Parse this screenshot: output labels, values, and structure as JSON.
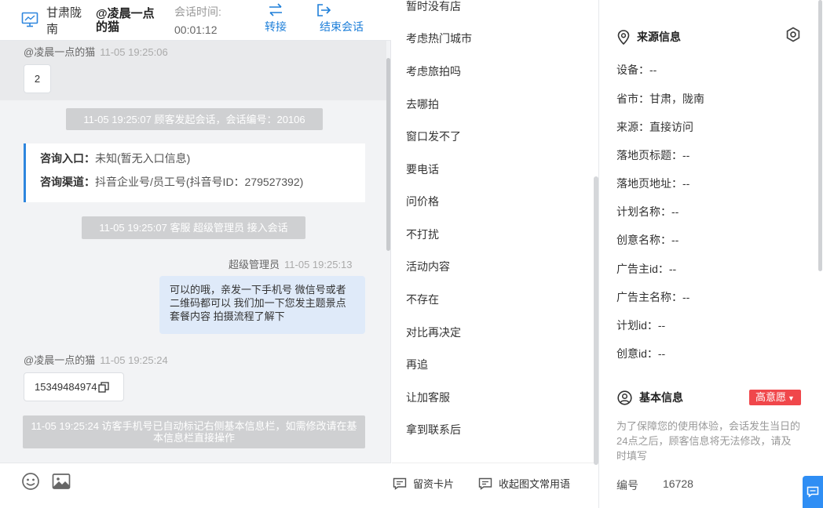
{
  "header": {
    "location": "甘肃陇南",
    "visitor_name": "@凌晨一点的猫",
    "session_time_label": "会话时间:",
    "session_time_value": "00:01:12",
    "transfer_label": "转接",
    "end_label": "结束会话"
  },
  "chat": {
    "msg1": {
      "sender": "@凌晨一点的猫",
      "time": "11-05 19:25:06",
      "text": "2"
    },
    "sys1": "11-05 19:25:07 顾客发起会话，会话编号：20106",
    "info_card": {
      "entry_label": "咨询入口：",
      "entry_value": "未知(暂无入口信息)",
      "channel_label": "咨询渠道：",
      "channel_value": "抖音企业号/员工号(抖音号ID：279527392)"
    },
    "sys2": "11-05 19:25:07 客服 超级管理员 接入会话",
    "msg2": {
      "sender": "超级管理员",
      "time": "11-05 19:25:13",
      "text": "可以的哦，亲发一下手机号 微信号或者二维码都可以 我们加一下您发主题景点 套餐内容 拍摄流程了解下"
    },
    "msg3": {
      "sender": "@凌晨一点的猫",
      "time": "11-05 19:25:24",
      "text": "15349484974"
    },
    "sys3": "11-05 19:25:24 访客手机号已自动标记右侧基本信息栏，如需修改请在基本信息栏直接操作"
  },
  "quick_replies": [
    "暂时没有店",
    "考虑热门城市",
    "考虑旅拍吗",
    "去哪拍",
    "窗口发不了",
    "要电话",
    "问价格",
    "不打扰",
    "活动内容",
    "不存在",
    "对比再决定",
    "再追",
    "让加客服",
    "拿到联系后"
  ],
  "quick_footer": {
    "card_label": "留资卡片",
    "collapse_label": "收起图文常用语"
  },
  "source_info": {
    "title": "来源信息",
    "fields": [
      "设备：--",
      "省市：甘肃，陇南",
      "来源：直接访问",
      "落地页标题：--",
      "落地页地址：--",
      "计划名称：--",
      "创意名称：--",
      "广告主id：--",
      "广告主名称：--",
      "计划id：--",
      "创意id：--"
    ]
  },
  "basic_info": {
    "title": "基本信息",
    "intent_label": "高意愿",
    "notice": "为了保障您的使用体验，会话发生当日的24点之后，顾客信息将无法修改，请及时填写",
    "number_label": "编号",
    "number_value": "16728"
  },
  "colors": {
    "accent": "#1e7fd9",
    "intent": "#f0474b",
    "customer_bubble": "#dfeaf9"
  }
}
